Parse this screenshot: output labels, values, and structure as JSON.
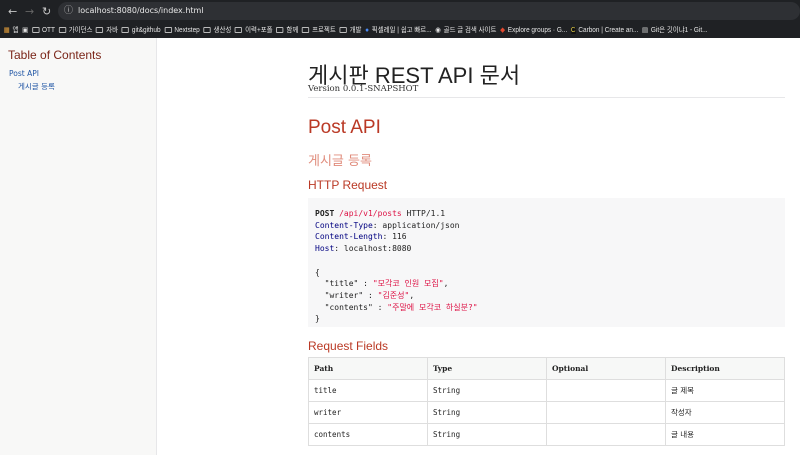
{
  "browser": {
    "url": "localhost:8080/docs/index.html",
    "bookmarks": [
      "앱",
      "OTT",
      "가이던스",
      "자바",
      "git&github",
      "Nextstep",
      "생산성",
      "이력+포폴",
      "함께",
      "프로젝트",
      "개발",
      "픽셀레일 | 쉽고 빠르...",
      "골드 글 검색 사이트",
      "Explore groups · G...",
      "Carbon | Create an...",
      "Git은 깃이냐1 - Git..."
    ]
  },
  "toc": {
    "title": "Table of Contents",
    "items": [
      "Post API",
      "게시글 등록"
    ]
  },
  "doc": {
    "title": "게시판 REST API 문서",
    "version": "Version 0.0.1-SNAPSHOT",
    "section": "Post API",
    "subsection": "게시글 등록",
    "http_request": "HTTP Request",
    "request_fields": "Request Fields"
  },
  "code": {
    "method": "POST",
    "path": "/api/v1/posts",
    "proto": "HTTP/1.1",
    "headers": [
      [
        "Content-Type",
        ": application/json"
      ],
      [
        "Content-Length",
        ": 116"
      ],
      [
        "Host",
        ": localhost:8080"
      ]
    ],
    "body": [
      [
        "\"title\"",
        "\"모각코 인원 모집\"",
        ","
      ],
      [
        "\"writer\"",
        "\"김준성\"",
        ","
      ],
      [
        "\"contents\"",
        "\"주말에 모각코 하실분?\"",
        ""
      ]
    ]
  },
  "table": {
    "headers": [
      "Path",
      "Type",
      "Optional",
      "Description"
    ],
    "rows": [
      [
        "title",
        "String",
        "",
        "글 제목"
      ],
      [
        "writer",
        "String",
        "",
        "작성자"
      ],
      [
        "contents",
        "String",
        "",
        "글 내용"
      ]
    ]
  }
}
